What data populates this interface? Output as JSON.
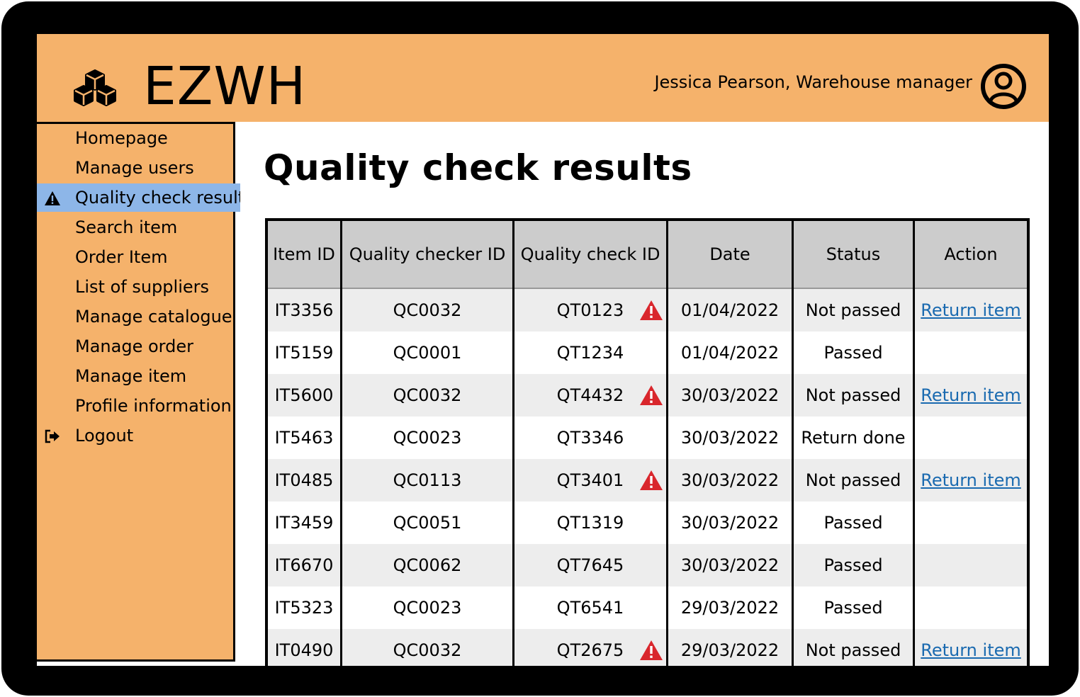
{
  "app": {
    "brand": "EZWH",
    "user": "Jessica Pearson, Warehouse manager"
  },
  "sidebar": {
    "items": [
      {
        "label": "Homepage",
        "icon": ""
      },
      {
        "label": "Manage users",
        "icon": ""
      },
      {
        "label": "Quality check results",
        "icon": "warning-icon",
        "active": true
      },
      {
        "label": "Search item",
        "icon": ""
      },
      {
        "label": "Order Item",
        "icon": ""
      },
      {
        "label": "List of suppliers",
        "icon": ""
      },
      {
        "label": "Manage catalogue",
        "icon": ""
      },
      {
        "label": "Manage order",
        "icon": ""
      },
      {
        "label": "Manage item",
        "icon": ""
      },
      {
        "label": "Profile information",
        "icon": ""
      },
      {
        "label": "Logout",
        "icon": "logout-icon"
      }
    ]
  },
  "main": {
    "title": "Quality check results",
    "table": {
      "headers": [
        "Item ID",
        "Quality checker ID",
        "Quality check ID",
        "Date",
        "Status",
        "Action"
      ],
      "rows": [
        {
          "item_id": "IT3356",
          "checker_id": "QC0032",
          "check_id": "QT0123",
          "warning": true,
          "date": "01/04/2022",
          "status": "Not passed",
          "action": "Return item"
        },
        {
          "item_id": "IT5159",
          "checker_id": "QC0001",
          "check_id": "QT1234",
          "warning": false,
          "date": "01/04/2022",
          "status": "Passed",
          "action": ""
        },
        {
          "item_id": "IT5600",
          "checker_id": "QC0032",
          "check_id": "QT4432",
          "warning": true,
          "date": "30/03/2022",
          "status": "Not passed",
          "action": "Return item"
        },
        {
          "item_id": "IT5463",
          "checker_id": "QC0023",
          "check_id": "QT3346",
          "warning": false,
          "date": "30/03/2022",
          "status": "Return done",
          "action": ""
        },
        {
          "item_id": "IT0485",
          "checker_id": "QC0113",
          "check_id": "QT3401",
          "warning": true,
          "date": "30/03/2022",
          "status": "Not passed",
          "action": "Return item"
        },
        {
          "item_id": "IT3459",
          "checker_id": "QC0051",
          "check_id": "QT1319",
          "warning": false,
          "date": "30/03/2022",
          "status": "Passed",
          "action": ""
        },
        {
          "item_id": "IT6670",
          "checker_id": "QC0062",
          "check_id": "QT7645",
          "warning": false,
          "date": "30/03/2022",
          "status": "Passed",
          "action": ""
        },
        {
          "item_id": "IT5323",
          "checker_id": "QC0023",
          "check_id": "QT6541",
          "warning": false,
          "date": "29/03/2022",
          "status": "Passed",
          "action": ""
        },
        {
          "item_id": "IT0490",
          "checker_id": "QC0032",
          "check_id": "QT2675",
          "warning": true,
          "date": "29/03/2022",
          "status": "Not passed",
          "action": "Return item"
        }
      ]
    }
  },
  "colors": {
    "header_bg": "#f5b26b",
    "active_nav": "#8db6e8",
    "link": "#1a6ab0",
    "warning": "#d9262c"
  }
}
